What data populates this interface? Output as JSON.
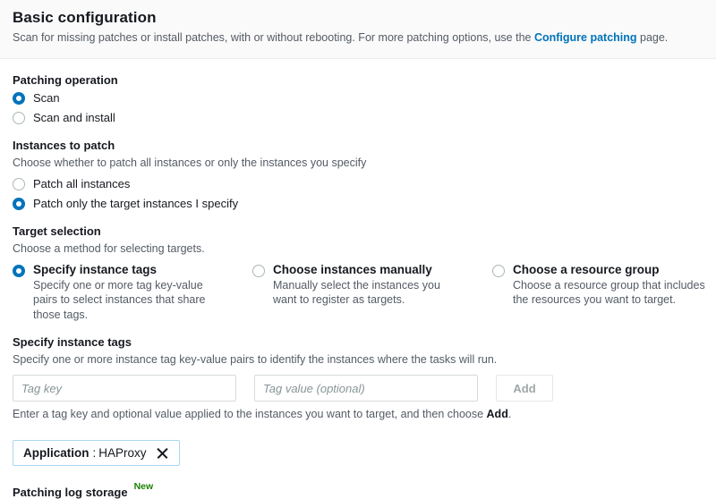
{
  "header": {
    "title": "Basic configuration",
    "description_before": "Scan for missing patches or install patches, with or without rebooting. For more patching options, use the ",
    "link_text": "Configure patching",
    "description_after": " page."
  },
  "patching_operation": {
    "label": "Patching operation",
    "options": [
      {
        "label": "Scan",
        "selected": true
      },
      {
        "label": "Scan and install",
        "selected": false
      }
    ]
  },
  "instances_to_patch": {
    "label": "Instances to patch",
    "hint": "Choose whether to patch all instances or only the instances you specify",
    "options": [
      {
        "label": "Patch all instances",
        "selected": false
      },
      {
        "label": "Patch only the target instances I specify",
        "selected": true
      }
    ]
  },
  "target_selection": {
    "label": "Target selection",
    "hint": "Choose a method for selecting targets.",
    "options": [
      {
        "title": "Specify instance tags",
        "description": "Specify one or more tag key-value pairs to select instances that share those tags.",
        "selected": true
      },
      {
        "title": "Choose instances manually",
        "description": "Manually select the instances you want to register as targets.",
        "selected": false
      },
      {
        "title": "Choose a resource group",
        "description": "Choose a resource group that includes the resources you want to target.",
        "selected": false
      }
    ]
  },
  "specify_instance_tags": {
    "label": "Specify instance tags",
    "hint": "Specify one or more instance tag key-value pairs to identify the instances where the tasks will run.",
    "tag_key_placeholder": "Tag key",
    "tag_key_value": "",
    "tag_value_placeholder": "Tag value (optional)",
    "tag_value_value": "",
    "add_button_label": "Add",
    "helper_before": "Enter a tag key and optional value applied to the instances you want to target, and then choose ",
    "helper_emphasis": "Add",
    "helper_after": ".",
    "chips": [
      {
        "key": "Application",
        "separator": ":",
        "value": "HAProxy",
        "remove_icon": "close-icon"
      }
    ]
  },
  "patching_log_storage": {
    "label": "Patching log storage",
    "badge": "New"
  },
  "colors": {
    "accent": "#0073bb",
    "link": "#0073bb",
    "text": "#16191f",
    "muted": "#545b64",
    "badge_green": "#1d8102",
    "chip_border": "#a9d7f0",
    "header_background": "#fafafa"
  }
}
